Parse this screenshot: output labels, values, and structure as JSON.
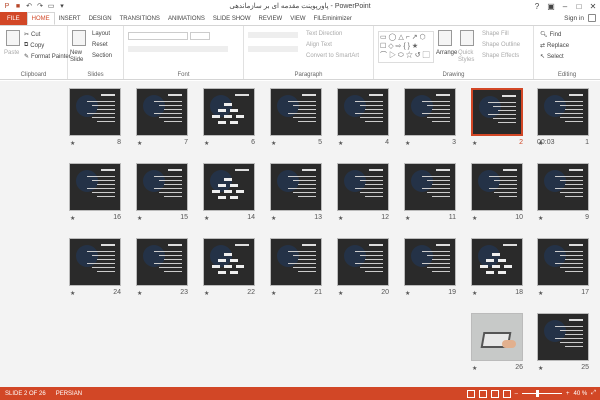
{
  "title": "پاورپوینت مقدمه ای بر سازماندهی - PowerPoint",
  "signin": "Sign in",
  "tabs": [
    "FILE",
    "HOME",
    "INSERT",
    "DESIGN",
    "TRANSITIONS",
    "ANIMATIONS",
    "SLIDE SHOW",
    "REVIEW",
    "VIEW",
    "FILEminimizer"
  ],
  "active_tab": "HOME",
  "ribbon": {
    "clipboard": {
      "label": "Clipboard",
      "paste": "Paste",
      "cut": "Cut",
      "copy": "Copy",
      "format_painter": "Format Painter"
    },
    "slides": {
      "label": "Slides",
      "new_slide": "New Slide",
      "layout": "Layout",
      "reset": "Reset",
      "section": "Section"
    },
    "font": {
      "label": "Font"
    },
    "paragraph": {
      "label": "Paragraph",
      "text_direction": "Text Direction",
      "align_text": "Align Text",
      "convert": "Convert to SmartArt"
    },
    "drawing": {
      "label": "Drawing",
      "arrange": "Arrange",
      "quick_styles": "Quick Styles",
      "shape_fill": "Shape Fill",
      "shape_outline": "Shape Outline",
      "shape_effects": "Shape Effects"
    },
    "editing": {
      "label": "Editing",
      "find": "Find",
      "replace": "Replace",
      "select": "Select"
    }
  },
  "slides_first_extra": "00:03",
  "selected_slide": 2,
  "slide_count": 26,
  "status": {
    "slide": "SLIDE 2 OF 26",
    "language": "PERSIAN",
    "zoom": "40 %"
  },
  "colors": {
    "accent": "#d24726"
  }
}
